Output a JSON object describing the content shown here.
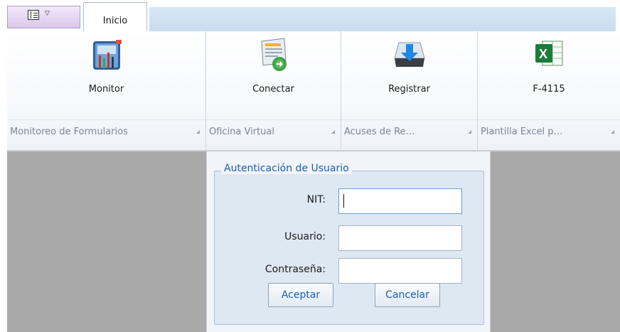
{
  "tabs": [
    {
      "label": "Inicio",
      "active": true
    }
  ],
  "quick_access": {
    "icon": "layout-menu-icon"
  },
  "ribbon": {
    "groups": [
      {
        "button_label": "Monitor",
        "caption": "Monitoreo de Formularios",
        "icon": "monitor-icon"
      },
      {
        "button_label": "Conectar",
        "caption": "Oficina Virtual",
        "icon": "connect-icon"
      },
      {
        "button_label": "Registrar",
        "caption": "Acuses de Re…",
        "icon": "download-tray-icon"
      },
      {
        "button_label": "F-4115",
        "caption": "Plantilla Excel p…",
        "icon": "excel-icon"
      }
    ]
  },
  "login": {
    "title": "Autenticación de Usuario",
    "nit_label": "NIT:",
    "nit_value": "",
    "usuario_label": "Usuario:",
    "usuario_value": "",
    "password_label": "Contraseña:",
    "password_value": "",
    "accept_label": "Aceptar",
    "cancel_label": "Cancelar"
  },
  "colors": {
    "workspace": "#a9a9a9",
    "legend": "#1a5fb4",
    "fieldset": "#dde8f3"
  }
}
